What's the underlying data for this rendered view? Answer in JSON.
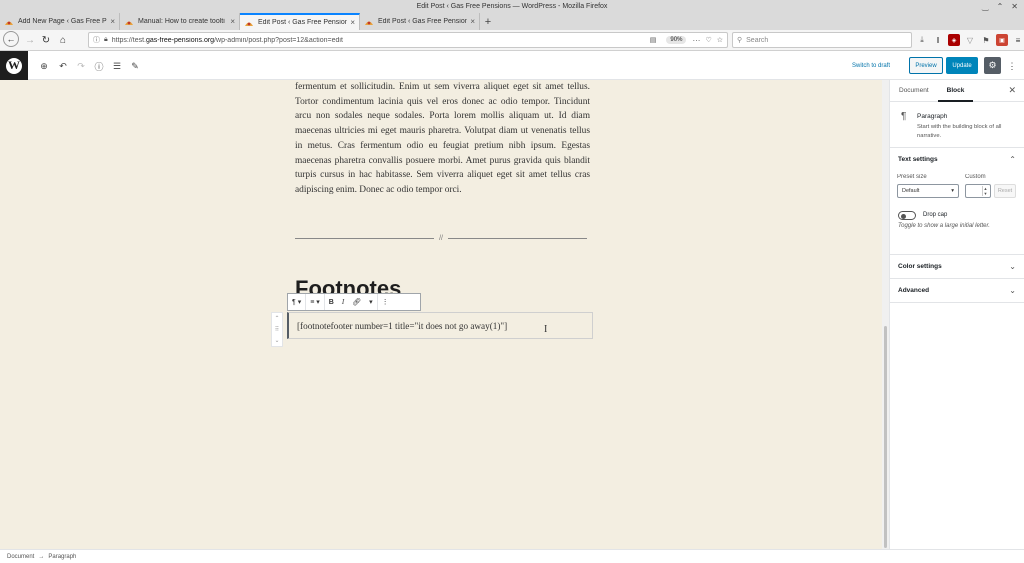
{
  "window": {
    "title": "Edit Post ‹ Gas Free Pensions — WordPress - Mozilla Firefox"
  },
  "tabs": [
    {
      "label": "Add New Page ‹ Gas Free Pen",
      "active": false
    },
    {
      "label": "Manual: How to create toolti",
      "active": false
    },
    {
      "label": "Edit Post ‹ Gas Free Pensions",
      "active": true
    },
    {
      "label": "Edit Post ‹ Gas Free Pensions",
      "active": false
    }
  ],
  "navbar": {
    "url_prefix": "https://test.",
    "url_domain": "gas-free-pensions.org",
    "url_path": "/wp-admin/post.php?post=12&action=edit",
    "zoom": "90%",
    "search_placeholder": "Search"
  },
  "editor_toolbar": {
    "switch_to_draft": "Switch to draft",
    "preview": "Preview",
    "update": "Update"
  },
  "content": {
    "paragraph": "fermentum et sollicitudin. Enim ut sem viverra aliquet eget sit amet tellus. Tortor condimentum lacinia quis vel eros donec ac odio tempor. Tincidunt arcu non sodales neque sodales. Porta lorem mollis aliquam ut. Id diam maecenas ultricies mi eget mauris pharetra. Volutpat diam ut venenatis tellus in metus. Cras fermentum odio eu feugiat pretium nibh ipsum. Egestas maecenas pharetra convallis posuere morbi. Amet purus gravida quis blandit turpis cursus in hac habitasse. Sem viverra aliquet eget sit amet tellus cras adipiscing enim. Donec ac odio tempor orci.",
    "separator_mark": "//",
    "heading": "Footnotes",
    "shortcode": "[footnotefooter number=1 title=\"it does not go away(1)\"]"
  },
  "sidebar": {
    "tabs": [
      "Document",
      "Block"
    ],
    "active_tab": "Block",
    "block_name": "Paragraph",
    "block_description": "Start with the building block of all narrative.",
    "text_settings": {
      "title": "Text settings",
      "preset_label": "Preset size",
      "custom_label": "Custom",
      "preset_value": "Default",
      "reset_label": "Reset",
      "drop_cap_label": "Drop cap",
      "drop_cap_help": "Toggle to show a large initial letter."
    },
    "color_settings": "Color settings",
    "advanced": "Advanced"
  },
  "breadcrumb": {
    "root": "Document",
    "arrow": "→",
    "current": "Paragraph"
  },
  "icons": {
    "back": "arrow-left",
    "forward": "arrow-right",
    "reload": "reload",
    "home": "home",
    "add_block": "plus-circle",
    "undo": "undo",
    "redo": "redo",
    "info": "info",
    "outline": "list",
    "edit": "pencil",
    "settings": "gear"
  },
  "colors": {
    "accent": "#0085ba",
    "canvas_bg": "#f3eee1",
    "firefox_tab_accent": "#0a84ff"
  }
}
